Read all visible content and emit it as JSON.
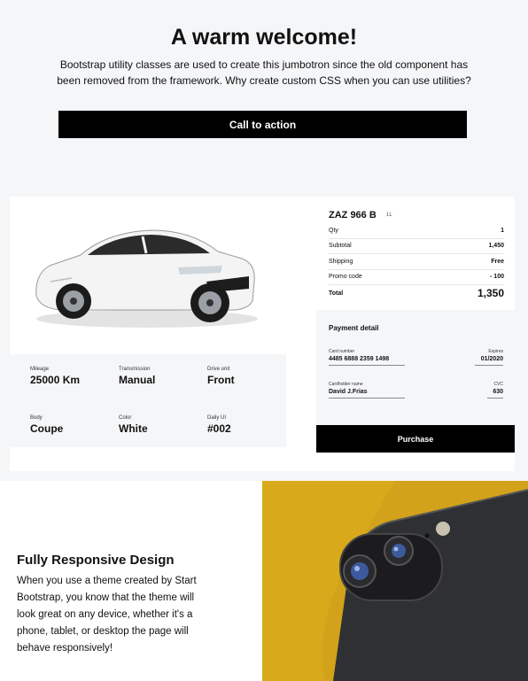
{
  "jumbotron": {
    "title": "A warm welcome!",
    "lead": "Bootstrap utility classes are used to create this jumbotron since the old component has been removed from the framework. Why create custom CSS when you can use utilities?",
    "cta_label": "Call to action"
  },
  "car": {
    "image_icon": "car-photo",
    "specs": [
      {
        "label": "Mileage",
        "value": "25000 Km"
      },
      {
        "label": "Transmission",
        "value": "Manual"
      },
      {
        "label": "Drive unit",
        "value": "Front"
      },
      {
        "label": "Body",
        "value": "Coupe"
      },
      {
        "label": "Color",
        "value": "White"
      },
      {
        "label": "Daily UI",
        "value": "#002"
      }
    ]
  },
  "order": {
    "plate": "ZAZ 966 B",
    "volume": "1L",
    "rows": [
      {
        "label": "Qty",
        "value": "1"
      },
      {
        "label": "Subtotal",
        "value": "1,450"
      },
      {
        "label": "Shipping",
        "value": "Free"
      },
      {
        "label": "Promo code",
        "value": "- 100"
      }
    ],
    "total_label": "Total",
    "total_value": "1,350"
  },
  "payment": {
    "title": "Payment detail",
    "card_number_label": "Card number",
    "card_number": "4485 6888 2359 1498",
    "expires_label": "Expires",
    "expires": "01/2020",
    "holder_label": "Cardholder name",
    "holder": "David J.Frias",
    "cvc_label": "CVC",
    "cvc": "630",
    "purchase_label": "Purchase"
  },
  "feature": {
    "title": "Fully Responsive Design",
    "text": "When you use a theme created by Start Bootstrap, you know that the theme will look great on any device, whether it's a phone, tablet, or desktop the page will behave responsively!",
    "image_icon": "phone-camera-photo",
    "image_bg": "#d9a91c"
  }
}
